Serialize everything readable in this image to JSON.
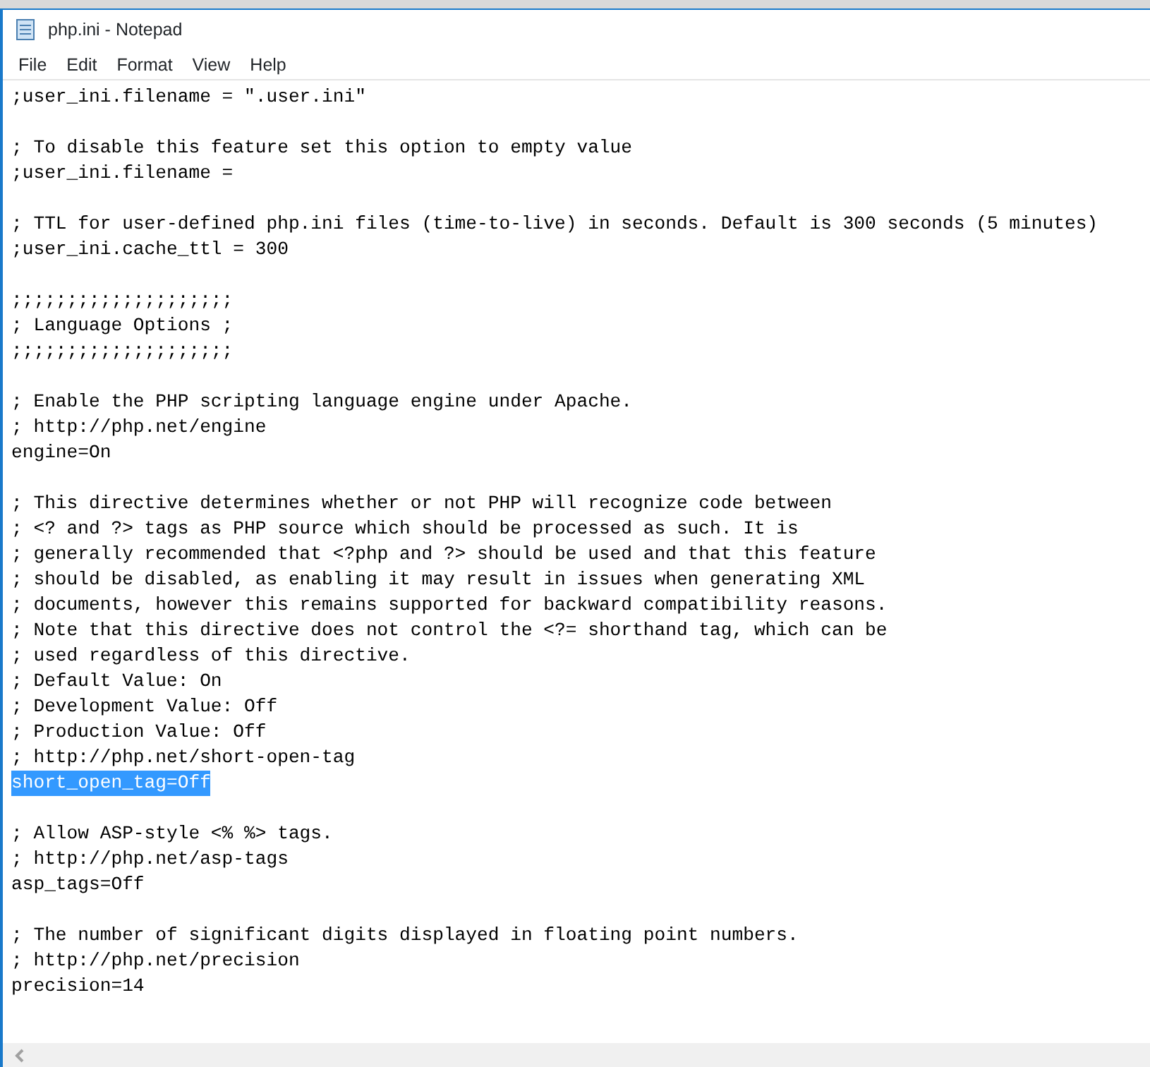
{
  "window": {
    "title": "php.ini - Notepad"
  },
  "menu": [
    "File",
    "Edit",
    "Format",
    "View",
    "Help"
  ],
  "blocks": [
    [
      {
        "text": ";user_ini.filename = \".user.ini\"",
        "selected": false
      }
    ],
    [
      {
        "text": "; To disable this feature set this option to empty value",
        "selected": false
      },
      {
        "text": ";user_ini.filename =",
        "selected": false
      }
    ],
    [
      {
        "text": "; TTL for user-defined php.ini files (time-to-live) in seconds. Default is 300 seconds (5 minutes)",
        "selected": false
      },
      {
        "text": ";user_ini.cache_ttl = 300",
        "selected": false
      }
    ],
    [
      {
        "text": ";;;;;;;;;;;;;;;;;;;;",
        "selected": false
      },
      {
        "text": "; Language Options ;",
        "selected": false
      },
      {
        "text": ";;;;;;;;;;;;;;;;;;;;",
        "selected": false
      }
    ],
    [
      {
        "text": "; Enable the PHP scripting language engine under Apache.",
        "selected": false
      },
      {
        "text": "; http://php.net/engine",
        "selected": false
      },
      {
        "text": "engine=On",
        "selected": false
      }
    ],
    [
      {
        "text": "; This directive determines whether or not PHP will recognize code between",
        "selected": false
      },
      {
        "text": "; <? and ?> tags as PHP source which should be processed as such. It is",
        "selected": false
      },
      {
        "text": "; generally recommended that <?php and ?> should be used and that this feature",
        "selected": false
      },
      {
        "text": "; should be disabled, as enabling it may result in issues when generating XML",
        "selected": false
      },
      {
        "text": "; documents, however this remains supported for backward compatibility reasons.",
        "selected": false
      },
      {
        "text": "; Note that this directive does not control the <?= shorthand tag, which can be",
        "selected": false
      },
      {
        "text": "; used regardless of this directive.",
        "selected": false
      },
      {
        "text": "; Default Value: On",
        "selected": false
      },
      {
        "text": "; Development Value: Off",
        "selected": false
      },
      {
        "text": "; Production Value: Off",
        "selected": false
      },
      {
        "text": "; http://php.net/short-open-tag",
        "selected": false
      },
      {
        "text": "short_open_tag=Off",
        "selected": true
      }
    ],
    [
      {
        "text": "; Allow ASP-style <% %> tags.",
        "selected": false
      },
      {
        "text": "; http://php.net/asp-tags",
        "selected": false
      },
      {
        "text": "asp_tags=Off",
        "selected": false
      }
    ],
    [
      {
        "text": "; The number of significant digits displayed in floating point numbers.",
        "selected": false
      },
      {
        "text": "; http://php.net/precision",
        "selected": false
      },
      {
        "text": "precision=14",
        "selected": false
      }
    ]
  ]
}
